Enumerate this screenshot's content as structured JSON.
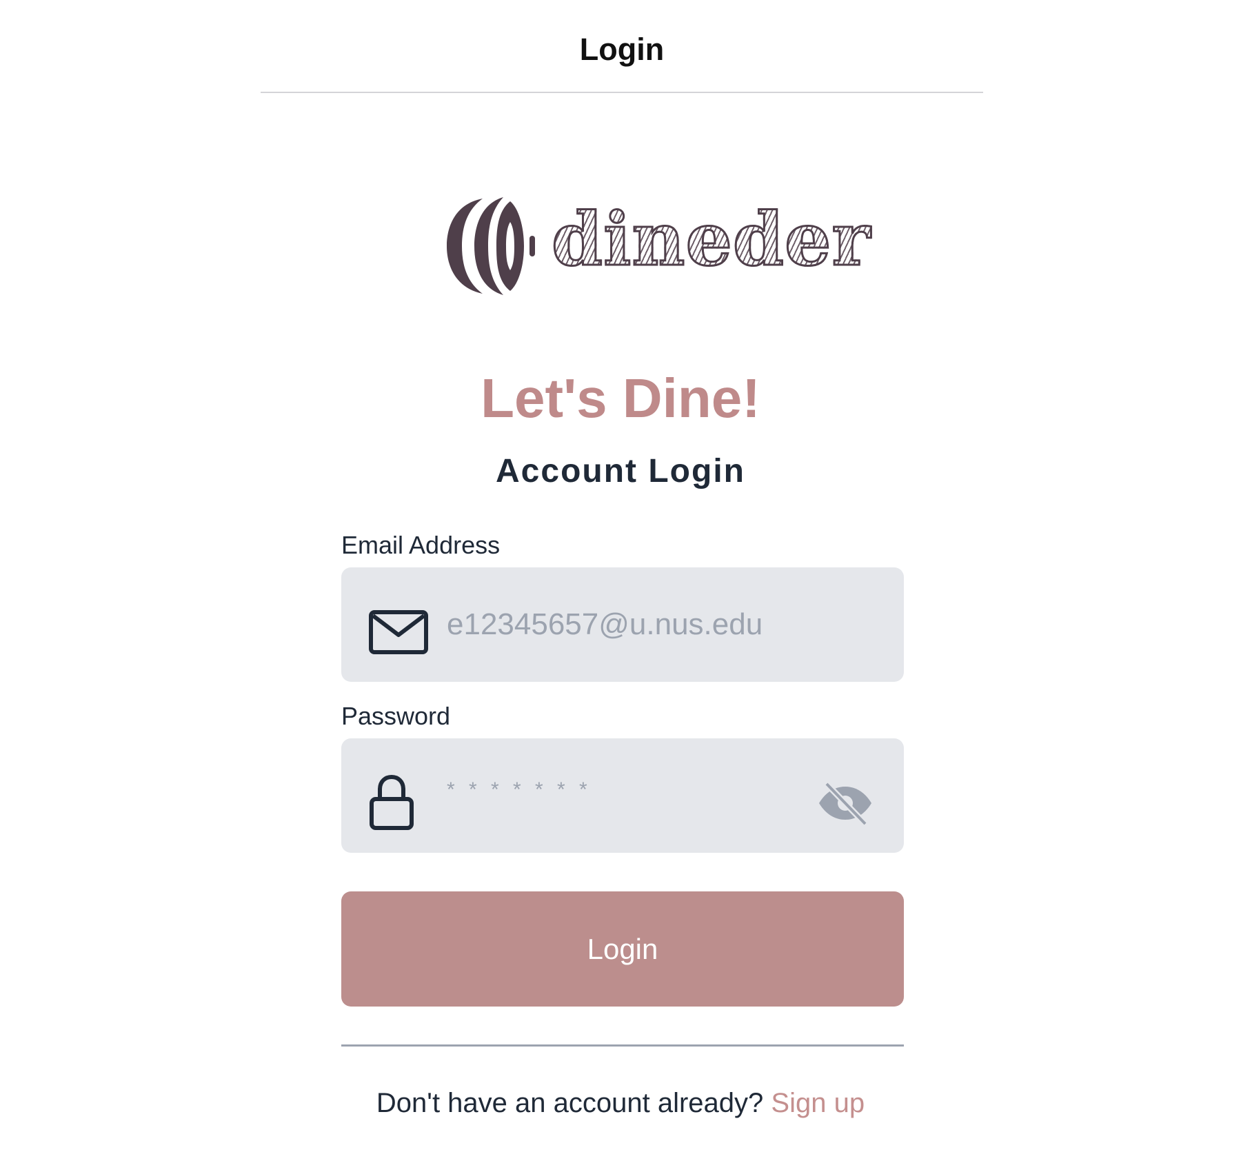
{
  "nav": {
    "title": "Login"
  },
  "brand": {
    "name": "dineder",
    "logo_color": "#4f3f4a"
  },
  "main": {
    "greeting": "Let's Dine!",
    "heading": "Account Login"
  },
  "form": {
    "email": {
      "label": "Email Address",
      "placeholder": "e12345657@u.nus.edu",
      "icon": "mail-icon"
    },
    "password": {
      "label": "Password",
      "placeholder": "* * * * * * *",
      "icon": "lock-icon",
      "toggle_icon": "eye-off-icon"
    },
    "submit_label": "Login"
  },
  "footer": {
    "prompt": "Don't have an account already?",
    "link_label": "Sign up"
  },
  "colors": {
    "accent": "#bc8e8d",
    "link": "#c48f8e",
    "field_bg": "#e5e7eb",
    "text_dark": "#1f2937"
  }
}
